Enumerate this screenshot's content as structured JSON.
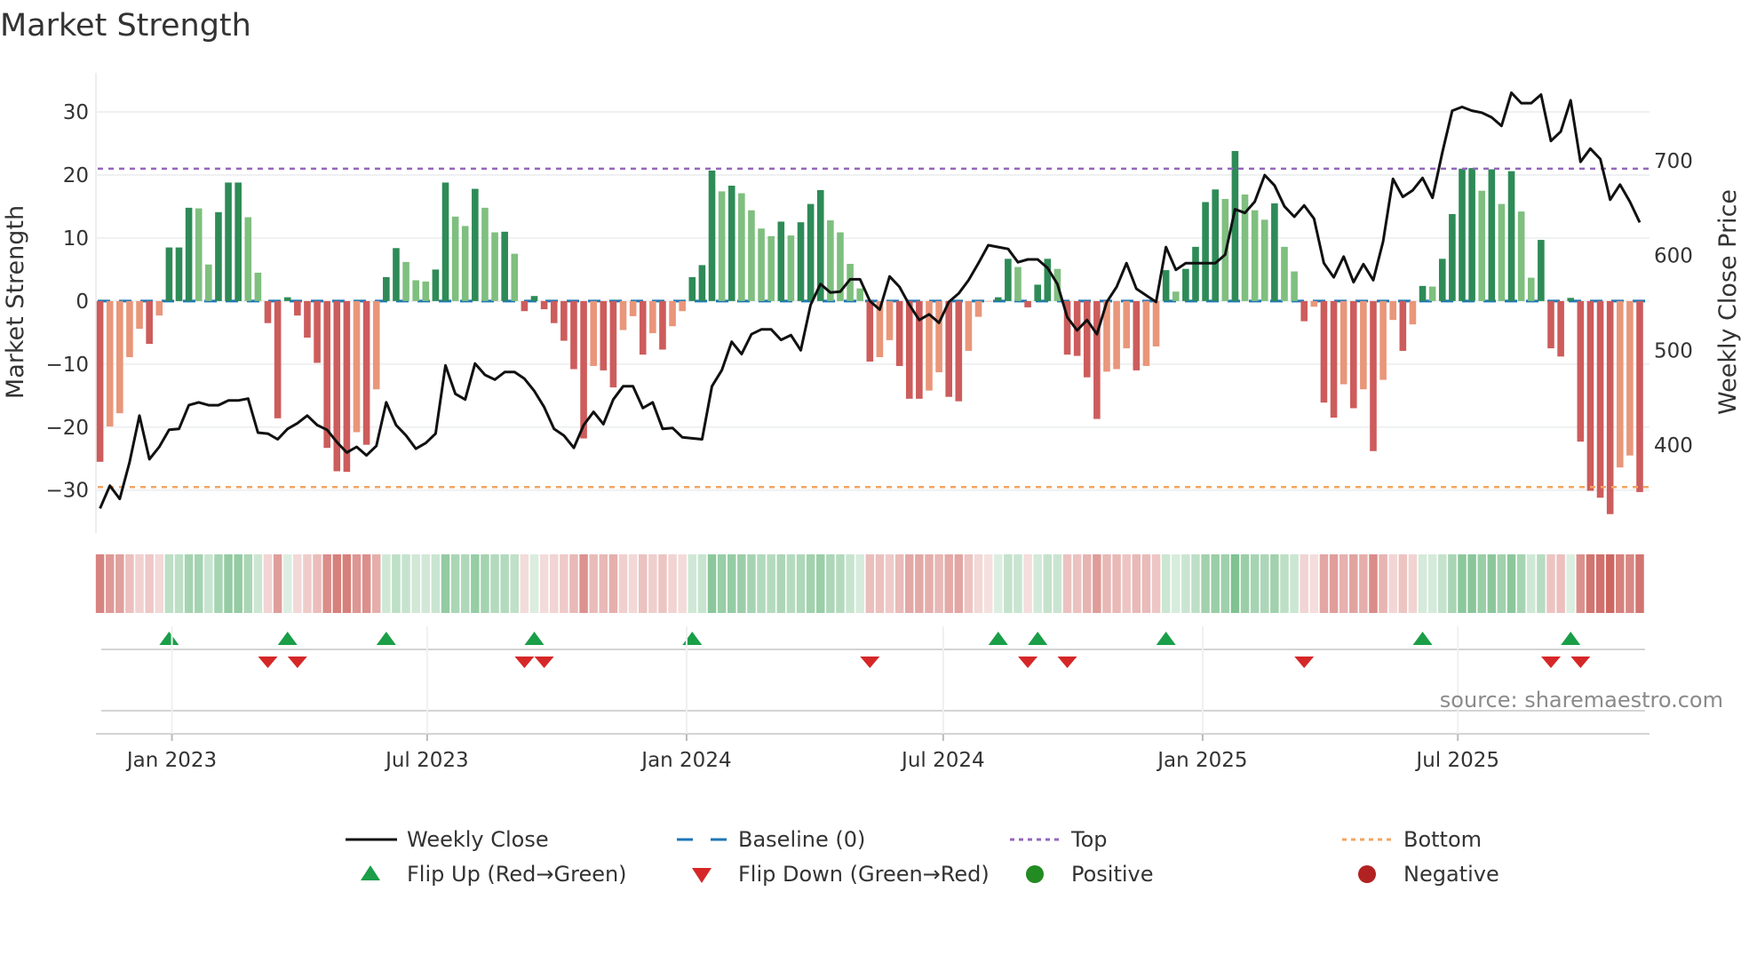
{
  "title": "Market Strength",
  "source": "source: sharemaestro.com",
  "colors": {
    "strong_positive": "#2e8b57",
    "weak_positive": "#7fbf7f",
    "strong_negative": "#cd5c5c",
    "weak_negative": "#e9967a",
    "weekly_close": "#111111",
    "baseline": "#1f77b4",
    "top": "#9467bd",
    "bottom": "#f4a460",
    "flip_up": "#1a9e48",
    "flip_down": "#d62728",
    "positive": "#228b22",
    "negative": "#b22222"
  },
  "chart_data": {
    "type": "bar+line",
    "ylabel": "Market Strength",
    "y2label": "Weekly Close Price",
    "ylim": [
      -36.8,
      36.2
    ],
    "y2lim": [
      307,
      793
    ],
    "yticks": [
      -30,
      -20,
      -10,
      0,
      10,
      20,
      30
    ],
    "y2ticks": [
      400,
      500,
      600,
      700
    ],
    "grid": true,
    "legend_placement": "bottom",
    "top_level": 21,
    "bottom_level": -29.5,
    "baseline": 0,
    "xticks": [
      {
        "date": "2023-01-01",
        "label": "Jan 2023"
      },
      {
        "date": "2023-07-01",
        "label": "Jul 2023"
      },
      {
        "date": "2024-01-01",
        "label": "Jan 2024"
      },
      {
        "date": "2024-07-01",
        "label": "Jul 2024"
      },
      {
        "date": "2025-01-01",
        "label": "Jan 2025"
      },
      {
        "date": "2025-07-01",
        "label": "Jul 2025"
      }
    ],
    "dates": [
      "2022-11-11",
      "2022-11-18",
      "2022-11-25",
      "2022-12-02",
      "2022-12-09",
      "2022-12-16",
      "2022-12-23",
      "2022-12-30",
      "2023-01-06",
      "2023-01-13",
      "2023-01-20",
      "2023-01-27",
      "2023-02-03",
      "2023-02-10",
      "2023-02-17",
      "2023-02-24",
      "2023-03-03",
      "2023-03-10",
      "2023-03-17",
      "2023-03-24",
      "2023-03-31",
      "2023-04-07",
      "2023-04-14",
      "2023-04-21",
      "2023-04-28",
      "2023-05-05",
      "2023-05-12",
      "2023-05-19",
      "2023-05-26",
      "2023-06-02",
      "2023-06-09",
      "2023-06-16",
      "2023-06-23",
      "2023-06-30",
      "2023-07-07",
      "2023-07-14",
      "2023-07-21",
      "2023-07-28",
      "2023-08-04",
      "2023-08-11",
      "2023-08-18",
      "2023-08-25",
      "2023-09-01",
      "2023-09-08",
      "2023-09-15",
      "2023-09-22",
      "2023-09-29",
      "2023-10-06",
      "2023-10-13",
      "2023-10-20",
      "2023-10-27",
      "2023-11-03",
      "2023-11-10",
      "2023-11-17",
      "2023-11-24",
      "2023-12-01",
      "2023-12-08",
      "2023-12-15",
      "2023-12-22",
      "2023-12-29",
      "2024-01-05",
      "2024-01-12",
      "2024-01-19",
      "2024-01-26",
      "2024-02-02",
      "2024-02-09",
      "2024-02-16",
      "2024-02-23",
      "2024-03-01",
      "2024-03-08",
      "2024-03-15",
      "2024-03-22",
      "2024-03-29",
      "2024-04-05",
      "2024-04-12",
      "2024-04-19",
      "2024-04-26",
      "2024-05-03",
      "2024-05-10",
      "2024-05-17",
      "2024-05-24",
      "2024-05-31",
      "2024-06-07",
      "2024-06-14",
      "2024-06-21",
      "2024-06-28",
      "2024-07-05",
      "2024-07-12",
      "2024-07-19",
      "2024-07-26",
      "2024-08-02",
      "2024-08-09",
      "2024-08-16",
      "2024-08-23",
      "2024-08-30",
      "2024-09-06",
      "2024-09-13",
      "2024-09-20",
      "2024-09-27",
      "2024-10-04",
      "2024-10-11",
      "2024-10-18",
      "2024-10-25",
      "2024-11-01",
      "2024-11-08",
      "2024-11-15",
      "2024-11-22",
      "2024-11-29",
      "2024-12-06",
      "2024-12-13",
      "2024-12-20",
      "2024-12-27",
      "2025-01-03",
      "2025-01-10",
      "2025-01-17",
      "2025-01-24",
      "2025-01-31",
      "2025-02-07",
      "2025-02-14",
      "2025-02-21",
      "2025-02-28",
      "2025-03-07",
      "2025-03-14",
      "2025-03-21",
      "2025-03-28",
      "2025-04-04",
      "2025-04-11",
      "2025-04-18",
      "2025-04-25",
      "2025-05-02",
      "2025-05-09",
      "2025-05-16",
      "2025-05-23",
      "2025-05-30",
      "2025-06-06",
      "2025-06-13",
      "2025-06-20",
      "2025-06-27",
      "2025-07-04",
      "2025-07-11",
      "2025-07-18",
      "2025-07-25",
      "2025-08-01",
      "2025-08-08",
      "2025-08-15",
      "2025-08-22",
      "2025-08-29",
      "2025-09-05",
      "2025-09-12",
      "2025-09-19",
      "2025-09-26",
      "2025-10-03",
      "2025-10-10",
      "2025-10-17",
      "2025-10-24",
      "2025-10-31",
      "2025-11-07"
    ],
    "strength": [
      -25.5,
      -19.9,
      -17.8,
      -8.9,
      -4.4,
      -6.8,
      -2.3,
      8.5,
      8.5,
      14.8,
      14.7,
      5.8,
      14.1,
      18.8,
      18.8,
      13.3,
      4.5,
      -3.5,
      -18.6,
      0.6,
      -2.3,
      -5.8,
      -9.8,
      -23.3,
      -27,
      -27.1,
      -20.8,
      -22.8,
      -14,
      3.8,
      8.4,
      6.2,
      3.3,
      3.1,
      5,
      18.8,
      13.4,
      11.9,
      17.8,
      14.8,
      10.9,
      11,
      7.5,
      -1.6,
      0.8,
      -1.3,
      -3.5,
      -6.3,
      -10.8,
      -21.8,
      -10.3,
      -11,
      -13.7,
      -4.6,
      -2.4,
      -8.5,
      -5.1,
      -7.7,
      -4,
      -1.6,
      3.8,
      5.7,
      20.7,
      17.4,
      18.3,
      17.1,
      14.4,
      11.5,
      10.3,
      12.6,
      10.4,
      12.5,
      15.4,
      17.6,
      12.8,
      10.9,
      5.9,
      2,
      -9.6,
      -8.9,
      -6.2,
      -10.3,
      -15.5,
      -15.5,
      -14.2,
      -11.3,
      -15.2,
      -15.9,
      -7.9,
      -2.5,
      0,
      0.6,
      6.7,
      5.4,
      -1,
      2.6,
      6.7,
      5.1,
      -8.5,
      -8.7,
      -12.1,
      -18.7,
      -11.2,
      -10.8,
      -7.5,
      -11,
      -10.3,
      -7.2,
      4.9,
      1.5,
      5.1,
      8.6,
      15.7,
      17.7,
      16.2,
      23.8,
      16.9,
      14.4,
      12.9,
      15.5,
      8.6,
      4.7,
      -3.2,
      -0.9,
      -16.1,
      -18.5,
      -13.2,
      -17,
      -14,
      -23.8,
      -12.5,
      -3,
      -7.9,
      -3.7,
      2.4,
      2.3,
      6.7,
      13.8,
      21,
      21.1,
      17.5,
      20.9,
      15.4,
      20.6,
      14.2,
      3.7,
      9.7,
      -7.5,
      -8.8,
      0.5,
      -22.3,
      -30.1,
      -31.2,
      -33.8,
      -26.4,
      -24.5,
      -30.3
    ],
    "weekly_close": [
      333,
      357,
      343,
      382,
      431,
      385,
      398,
      416,
      417,
      442,
      445,
      442,
      442,
      447,
      447,
      449,
      413,
      412,
      406,
      417,
      423,
      431,
      421,
      416,
      403,
      392,
      398,
      389,
      399,
      445,
      421,
      410,
      396,
      402,
      412,
      484,
      454,
      448,
      486,
      474,
      469,
      477,
      477,
      470,
      457,
      440,
      417,
      410,
      397,
      421,
      435,
      422,
      448,
      462,
      462,
      439,
      445,
      417,
      418,
      408,
      407,
      406,
      462,
      479,
      509,
      496,
      517,
      522,
      522,
      511,
      516,
      500,
      548,
      570,
      561,
      562,
      575,
      575,
      552,
      543,
      578,
      567,
      548,
      532,
      538,
      529,
      551,
      560,
      574,
      592,
      611,
      609,
      607,
      593,
      596,
      596,
      587,
      570,
      535,
      521,
      532,
      517,
      551,
      567,
      592,
      565,
      558,
      551,
      609,
      585,
      592,
      592,
      592,
      592,
      601,
      649,
      645,
      657,
      685,
      674,
      652,
      641,
      653,
      639,
      592,
      577,
      599,
      572,
      591,
      574,
      615,
      681,
      662,
      669,
      682,
      661,
      709,
      753,
      757,
      753,
      751,
      746,
      737,
      772,
      761,
      761,
      770,
      721,
      731,
      764,
      699,
      713,
      702,
      659,
      675,
      657,
      635
    ],
    "legend": [
      {
        "key": "weekly_close",
        "label": "Weekly Close"
      },
      {
        "key": "baseline",
        "label": "Baseline (0)"
      },
      {
        "key": "top",
        "label": "Top"
      },
      {
        "key": "bottom",
        "label": "Bottom"
      },
      {
        "key": "flip_up",
        "label": "Flip Up (Red→Green)"
      },
      {
        "key": "flip_down",
        "label": "Flip Down (Green→Red)"
      },
      {
        "key": "positive",
        "label": "Positive"
      },
      {
        "key": "negative",
        "label": "Negative"
      }
    ]
  }
}
